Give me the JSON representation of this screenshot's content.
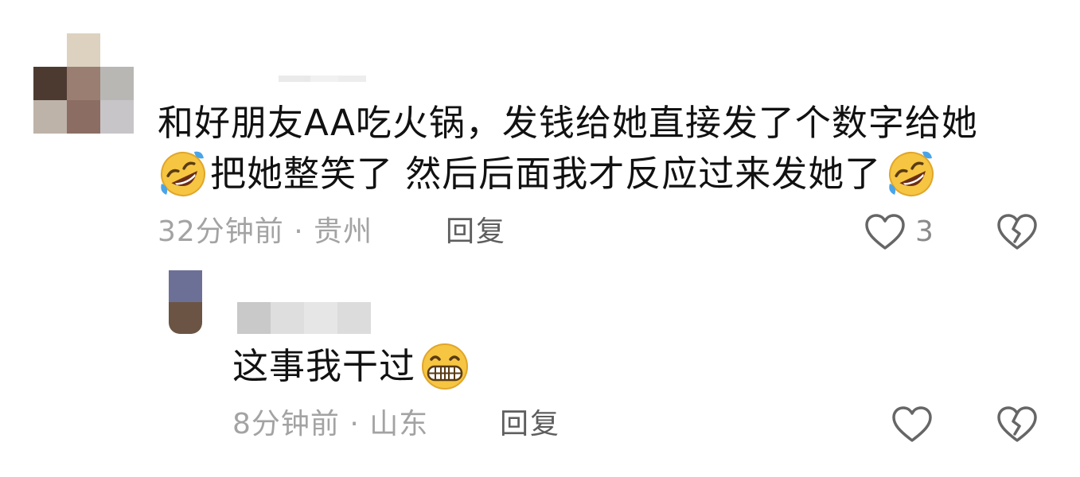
{
  "comments": [
    {
      "text_line1": "和好朋友AA吃火锅，发钱给她直接发了个数字给她",
      "text_line2_a": "把她整笑了 然后后面我才反应过来发她了",
      "emoji_leading": "rolling-on-floor-laughing-emoji",
      "emoji_trailing": "rolling-on-floor-laughing-emoji",
      "time": "32分钟前",
      "separator": "·",
      "location": "贵州",
      "reply_label": "回复",
      "like_count": "3"
    },
    {
      "text": "这事我干过",
      "emoji_trailing": "grinning-face-emoji",
      "time": "8分钟前",
      "separator": "·",
      "location": "山东",
      "reply_label": "回复"
    }
  ],
  "icons": {
    "like": "heart-outline-icon",
    "dislike": "broken-heart-icon"
  },
  "colors": {
    "primary_text": "#111111",
    "meta_text": "#a3a3a3",
    "reply_text": "#5e5e5e",
    "icon_stroke": "#666666",
    "emoji_yellow": "#f6c542"
  }
}
